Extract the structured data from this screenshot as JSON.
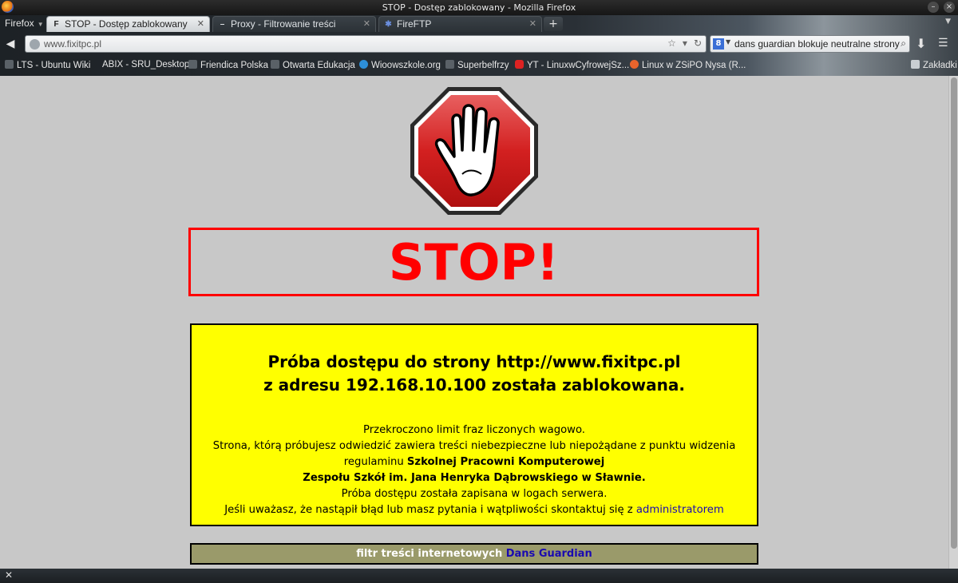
{
  "window": {
    "title": "STOP - Dostęp zablokowany - Mozilla Firefox"
  },
  "toolbar": {
    "firefox_menu": "Firefox",
    "tabs": [
      {
        "label": "STOP - Dostęp zablokowany",
        "favicon": "F",
        "active": true
      },
      {
        "label": "Proxy - Filtrowanie treści",
        "favicon": "",
        "active": false
      },
      {
        "label": "FireFTP",
        "favicon": "",
        "active": false
      }
    ],
    "new_tab": "+",
    "url": "www.fixitpc.pl",
    "search_engine": "8",
    "search_query": "dans guardian blokuje neutralne strony",
    "bookmarks": [
      {
        "label": "LTS - Ubuntu Wiki",
        "icon": "page"
      },
      {
        "label": "ABIX - SRU_Desktop",
        "icon": "none"
      },
      {
        "label": "Friendica Polska",
        "icon": "page"
      },
      {
        "label": "Otwarta Edukacja",
        "icon": "page"
      },
      {
        "label": "Wioowszkole.org",
        "icon": "wio"
      },
      {
        "label": "Superbelfrzy",
        "icon": "page"
      },
      {
        "label": "YT - LinuxwCyfrowejSz...",
        "icon": "yt"
      },
      {
        "label": "Linux w ZSiPO Nysa (R...",
        "icon": "joomla"
      },
      {
        "label": "Zakładki",
        "icon": "bookmarks"
      }
    ]
  },
  "page": {
    "stop_word": "STOP!",
    "headline_line1": "Próba dostępu do strony http://www.fixitpc.pl",
    "headline_line2": "z adresu 192.168.10.100 została zablokowana.",
    "line1": "Przekroczono limit fraz liczonych wagowo.",
    "line2": "Strona, którą próbujesz odwiedzić zawiera treści niebezpieczne lub niepożądane z punktu widzenia",
    "line3_prefix": "regulaminu ",
    "line3_bold": "Szkolnej Pracowni Komputerowej",
    "line4_bold": "Zespołu Szkół im. Jana Henryka Dąbrowskiego w Sławnie.",
    "line5": "Próba dostępu została zapisana w logach serwera.",
    "line6_prefix": "Jeśli uważasz, że nastąpił błąd lub masz pytania i wątpliwości skontaktuj się z ",
    "admin_link": "administratorem",
    "footer_prefix": "filtr treści internetowych ",
    "footer_link": "Dans Guardian"
  },
  "colors": {
    "stop_red": "#ff0000",
    "notice_bg": "#ffff00",
    "footer_bg": "#9a9a6a",
    "link": "#1a0ab0"
  }
}
